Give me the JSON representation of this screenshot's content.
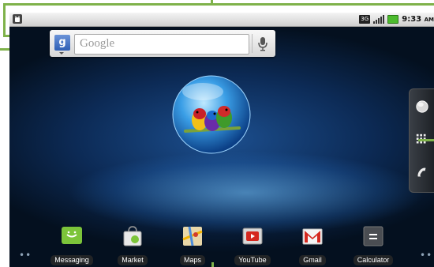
{
  "status_bar": {
    "time": "9:33",
    "ampm": "AM",
    "network": "3G"
  },
  "search_widget": {
    "placeholder": "Google"
  },
  "apps": [
    {
      "label": "Messaging"
    },
    {
      "label": "Market"
    },
    {
      "label": "Maps"
    },
    {
      "label": "YouTube"
    },
    {
      "label": "Gmail"
    },
    {
      "label": "Calculator"
    }
  ],
  "page_indicator": {
    "left": "••",
    "right": "••"
  },
  "colors": {
    "callout": "#7fb24a",
    "battery": "#4cbb2e"
  }
}
